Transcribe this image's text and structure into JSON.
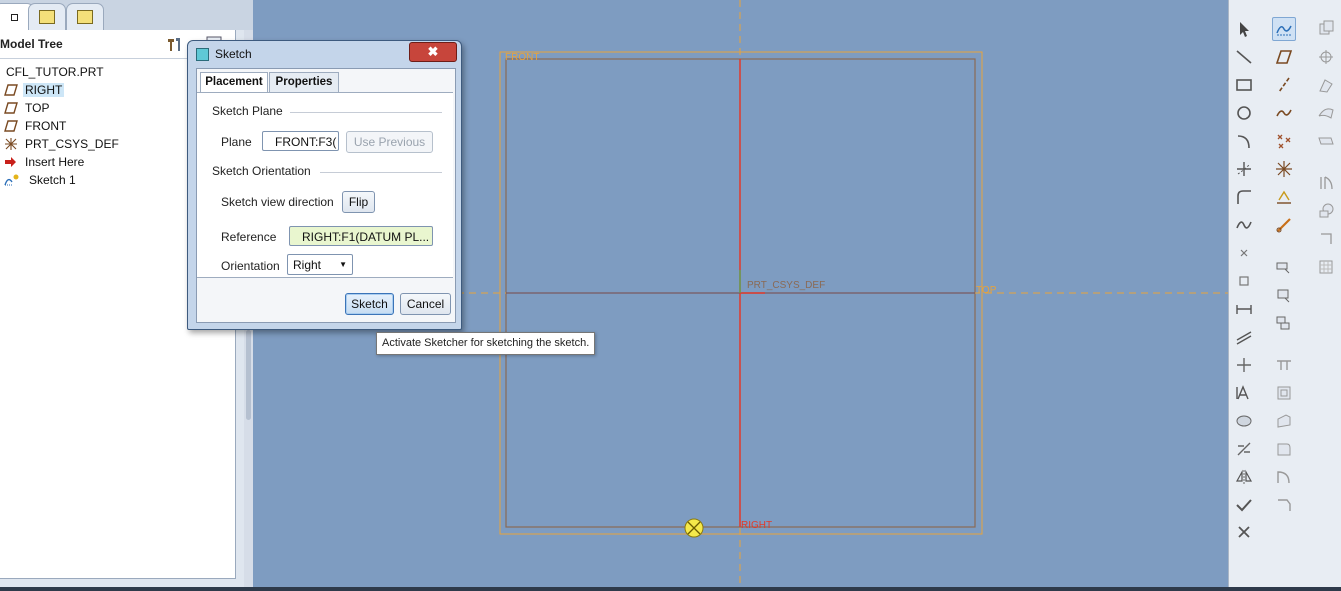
{
  "model_tree": {
    "title": "Model Tree",
    "tabs": [
      "model-tree-tab",
      "layers-tab",
      "favorites-tab"
    ],
    "items": [
      {
        "label": "CFL_TUTOR.PRT",
        "icon": "part-icon"
      },
      {
        "label": "RIGHT",
        "icon": "datum-plane-icon",
        "selected": true
      },
      {
        "label": "TOP",
        "icon": "datum-plane-icon"
      },
      {
        "label": "FRONT",
        "icon": "datum-plane-icon"
      },
      {
        "label": "PRT_CSYS_DEF",
        "icon": "csys-icon"
      },
      {
        "label": "Insert Here",
        "icon": "insert-arrow-icon"
      },
      {
        "label": "Sketch 1",
        "icon": "sketch-icon"
      }
    ]
  },
  "graphics": {
    "labels": {
      "front": "FRONT",
      "top": "TOP",
      "right": "RIGHT",
      "csys": "PRT_CSYS_DEF"
    },
    "colors": {
      "background": "#7e9cc1",
      "datum_orange": "#e8a33a",
      "red_axis": "#e23a2a",
      "plane_edge": "#8a6a55"
    }
  },
  "dialog": {
    "title": "Sketch",
    "close": "✖",
    "tabs": {
      "placement": "Placement",
      "properties": "Properties"
    },
    "sketch_plane": {
      "section": "Sketch Plane",
      "plane_label": "Plane",
      "plane_value": "FRONT:F3(",
      "use_previous": "Use Previous"
    },
    "orientation": {
      "section": "Sketch Orientation",
      "view_direction_label": "Sketch view direction",
      "flip": "Flip",
      "reference_label": "Reference",
      "reference_value": "RIGHT:F1(DATUM PL...",
      "orientation_label": "Orientation",
      "orientation_value": "Right"
    },
    "buttons": {
      "sketch": "Sketch",
      "cancel": "Cancel"
    }
  },
  "tooltip": "Activate Sketcher for sketching the sketch.",
  "toolbar": {
    "icons": [
      "select-arrow-icon",
      "sketch-tool-icon",
      "line-icon",
      "plane-icon",
      "rectangle-icon",
      "axis-icon",
      "circle-icon",
      "curve-icon",
      "arc-icon",
      "point-icon",
      "fillet-icon",
      "csys-tool-icon",
      "spline-icon",
      "analysis-icon",
      "dimension-icon",
      "annotation-icon",
      "constraint-icon",
      "text-icon",
      "palette-icon",
      "mirror-icon",
      "ok-check-icon",
      "cancel-x-icon"
    ]
  }
}
